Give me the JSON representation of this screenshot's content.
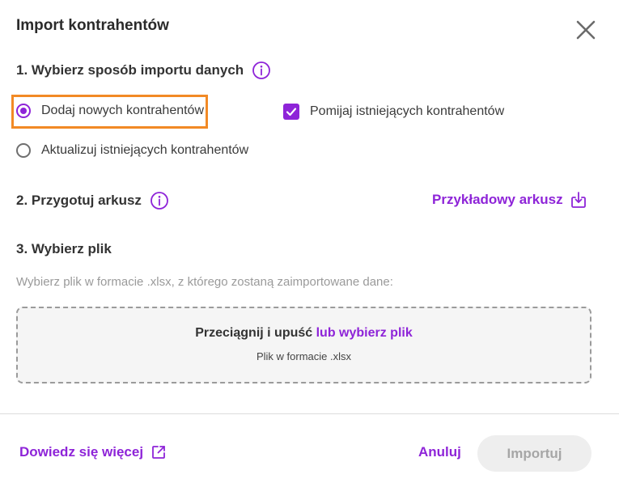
{
  "dialog": {
    "title": "Import kontrahentów"
  },
  "section1": {
    "heading": "1. Wybierz sposób importu danych",
    "options": [
      {
        "label": "Dodaj nowych kontrahentów",
        "selected": true
      },
      {
        "label": "Aktualizuj istniejących kontrahentów",
        "selected": false
      }
    ],
    "skip_existing": {
      "label": "Pomijaj istniejących kontrahentów",
      "checked": true
    }
  },
  "section2": {
    "heading": "2. Przygotuj arkusz",
    "sample_link": "Przykładowy arkusz"
  },
  "section3": {
    "heading": "3. Wybierz plik",
    "hint": "Wybierz plik w formacie .xlsx, z którego zostaną zaimportowane dane:",
    "dropzone": {
      "main_text": "Przeciągnij i upuść ",
      "link_text": "lub wybierz plik",
      "sub_text": "Plik w formacie .xlsx"
    }
  },
  "footer": {
    "learn_more": "Dowiedz się więcej",
    "cancel": "Anuluj",
    "import": "Importuj"
  },
  "colors": {
    "accent": "#8e24d8",
    "highlight": "#f28a25",
    "disabled_bg": "#eeeeee"
  }
}
